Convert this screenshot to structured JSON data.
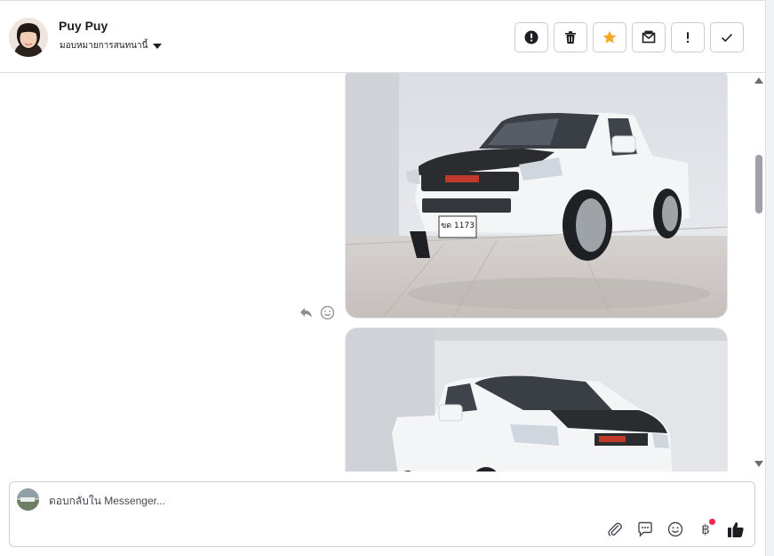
{
  "header": {
    "contact_name": "Puy Puy",
    "assign_label": "มอบหมายการสนทนานี้",
    "actions": [
      {
        "name": "spam-button",
        "icon": "alert-circle-icon"
      },
      {
        "name": "delete-button",
        "icon": "trash-icon"
      },
      {
        "name": "star-button",
        "icon": "star-icon"
      },
      {
        "name": "mark-unread-button",
        "icon": "envelope-icon"
      },
      {
        "name": "follow-up-button",
        "icon": "exclamation-icon"
      },
      {
        "name": "done-button",
        "icon": "check-icon"
      }
    ]
  },
  "messages": {
    "images": [
      {
        "subject": "white Isuzu pickup truck front view",
        "plate": "ขด 1173"
      },
      {
        "subject": "white Isuzu pickup truck side view"
      }
    ],
    "tools": [
      "reply-icon",
      "emoji-reaction-icon"
    ]
  },
  "composer": {
    "placeholder": "ตอบกลับใน Messenger...",
    "currency_symbol": "฿",
    "tools": [
      "attachment-icon",
      "saved-replies-icon",
      "emoji-icon",
      "payment-icon",
      "thumbs-up-icon"
    ]
  },
  "colors": {
    "star": "#f5a623",
    "notification_dot": "#f02849",
    "thumbs_up": "#1c1e21",
    "border": "#c9ccd1"
  }
}
